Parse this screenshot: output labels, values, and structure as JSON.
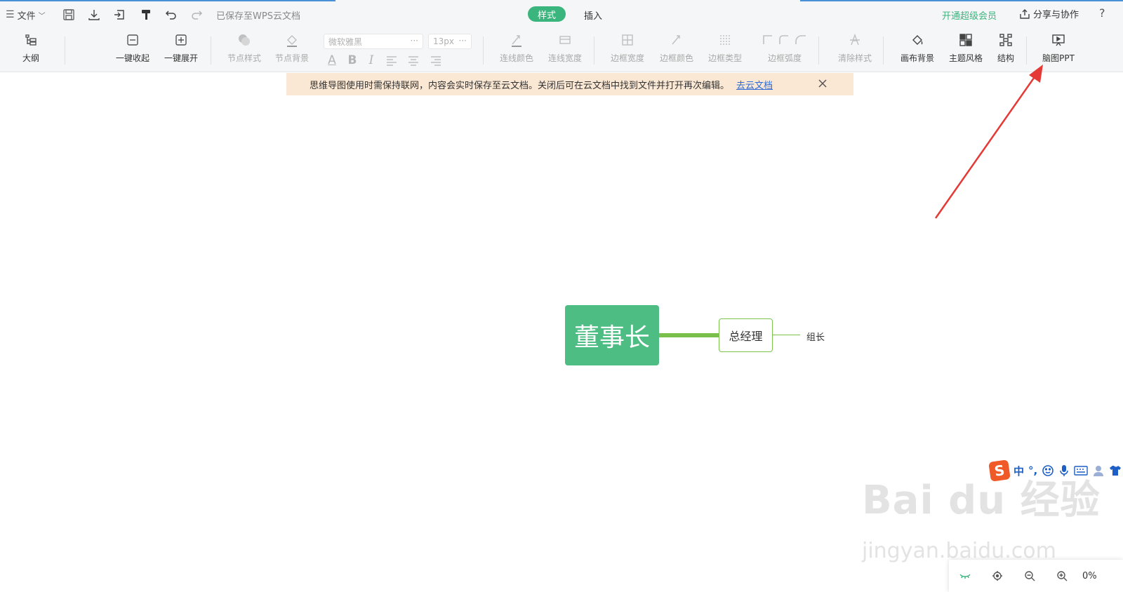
{
  "top": {
    "file_menu": "文件",
    "saved_status": "已保存至WPS云文档",
    "tabs": [
      {
        "label": "样式",
        "active": true
      },
      {
        "label": "插入",
        "active": false
      }
    ],
    "vip_link": "开通超级会员",
    "share_button": "分享与协作",
    "help_icon": "?"
  },
  "toolbar": {
    "outline": "大纲",
    "collapse_all": "一键收起",
    "expand_all": "一键展开",
    "node_style": "节点样式",
    "node_bg": "节点背景",
    "font_family_placeholder": "微软雅黑",
    "font_size_placeholder": "13px",
    "font_dots": "···",
    "line_color": "连线颜色",
    "line_width": "连线宽度",
    "border_width": "边框宽度",
    "border_color": "边框颜色",
    "border_type": "边框类型",
    "border_radius": "边框弧度",
    "clear_style": "清除样式",
    "canvas_bg": "画布背景",
    "theme_style": "主题风格",
    "structure": "结构",
    "mind_ppt": "脑图PPT"
  },
  "notice": {
    "text": "思维导图使用时需保持联网，内容会实时保存至云文档。关闭后可在云文档中找到文件并打开再次编辑。",
    "link": "去云文档"
  },
  "mindmap": {
    "root": "董事长",
    "child": "总经理",
    "grandchild": "组长"
  },
  "ime": {
    "logo": "S",
    "mode": "中",
    "punct": "°,"
  },
  "watermark": {
    "line1": "Bai du 经验",
    "line2": "jingyan.baidu.com"
  },
  "bottom": {
    "zoom": "0%"
  },
  "colors": {
    "accent": "#3ab57d",
    "root_node": "#4dbd84",
    "branch": "#79c04a",
    "notice_bg": "#fbe8d4",
    "arrow": "#e53935"
  }
}
